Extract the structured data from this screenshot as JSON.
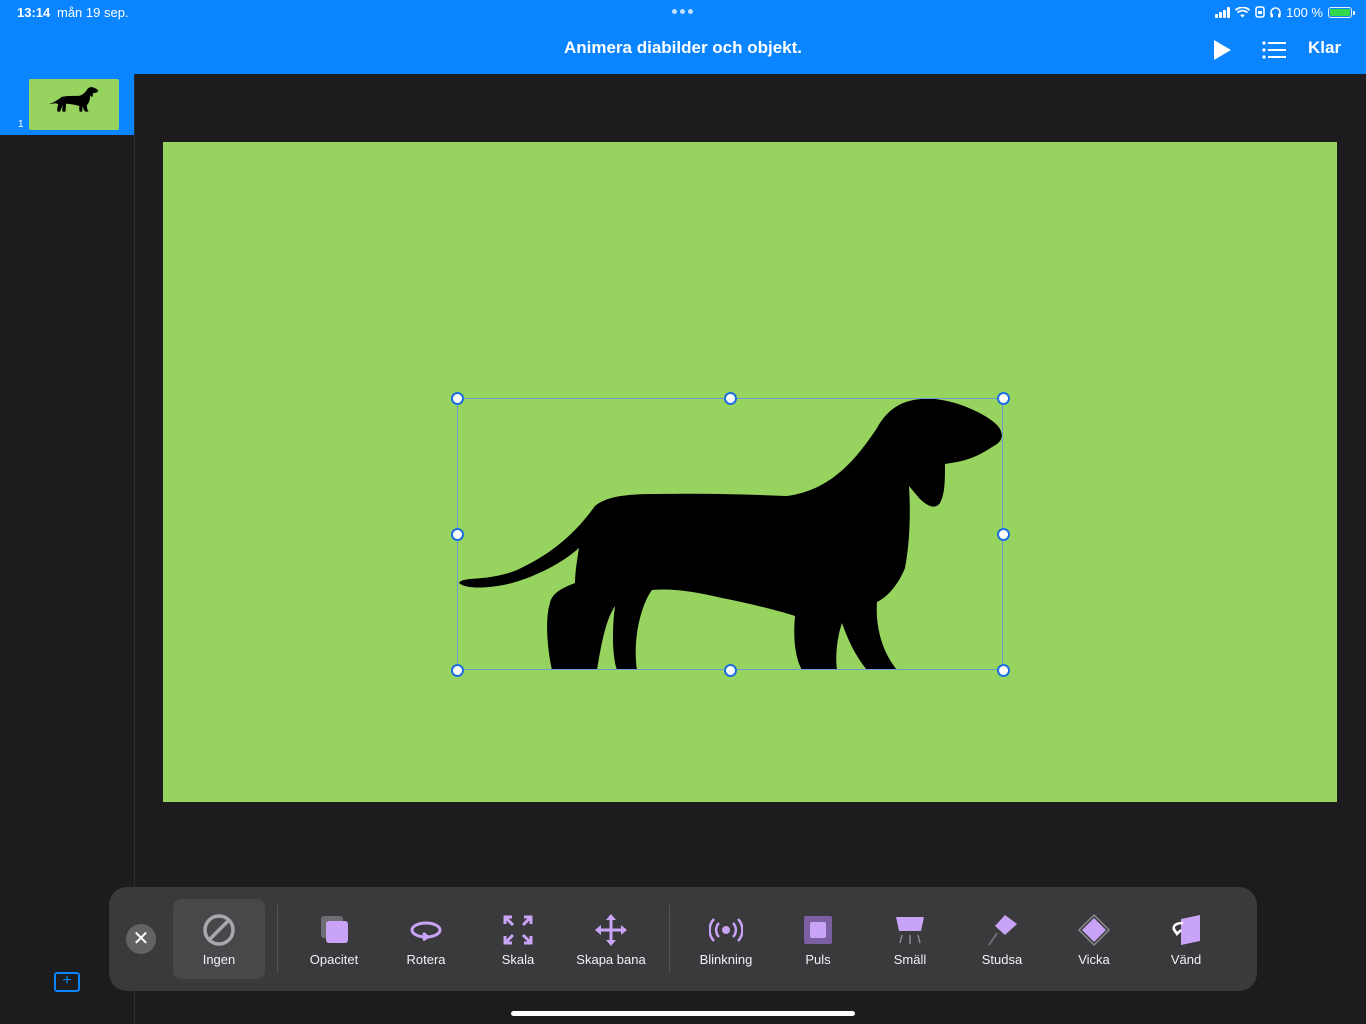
{
  "status_bar": {
    "time": "13:14",
    "date": "mån 19 sep.",
    "battery": "100 %"
  },
  "header": {
    "title": "Animera diabilder och objekt.",
    "done_label": "Klar"
  },
  "navigator": {
    "slides": [
      {
        "number": "1"
      }
    ]
  },
  "colors": {
    "accent": "#0a84ff",
    "slide_bg": "#96d35f",
    "toolbar_bg": "#3a3a3c",
    "icon_purple": "#c9a3f5"
  },
  "animations": {
    "selected": "Ingen",
    "items": [
      {
        "label": "Ingen",
        "icon": "none-icon"
      },
      {
        "label": "Opacitet",
        "icon": "opacity-icon"
      },
      {
        "label": "Rotera",
        "icon": "rotate-icon"
      },
      {
        "label": "Skala",
        "icon": "scale-icon"
      },
      {
        "label": "Skapa bana",
        "icon": "create-path-icon"
      },
      {
        "label": "Blinkning",
        "icon": "blink-icon"
      },
      {
        "label": "Puls",
        "icon": "pulse-icon"
      },
      {
        "label": "Smäll",
        "icon": "pop-icon"
      },
      {
        "label": "Studsa",
        "icon": "bounce-icon"
      },
      {
        "label": "Vicka",
        "icon": "jiggle-icon"
      },
      {
        "label": "Vänd",
        "icon": "flip-icon"
      }
    ]
  }
}
